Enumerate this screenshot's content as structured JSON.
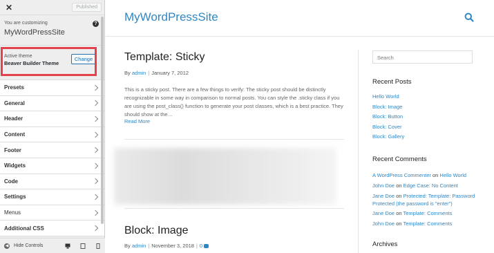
{
  "sidebar": {
    "close_icon": "close-icon",
    "published_label": "Published",
    "customizing_label": "You are customizing",
    "site_name": "MyWordPressSite",
    "help_icon": "?",
    "active_theme_label": "Active theme",
    "theme_name": "Beaver Builder Theme",
    "change_label": "Change",
    "items": [
      {
        "label": "Presets"
      },
      {
        "label": "General"
      },
      {
        "label": "Header"
      },
      {
        "label": "Content"
      },
      {
        "label": "Footer"
      },
      {
        "label": "Widgets"
      },
      {
        "label": "Code"
      },
      {
        "label": "Settings"
      },
      {
        "label": "Menus"
      },
      {
        "label": "Additional CSS"
      }
    ],
    "hide_controls_label": "Hide Controls",
    "highlight_color": "#e5414a"
  },
  "preview": {
    "site_title": "MyWordPressSite",
    "accent_color": "#2e87c7",
    "posts": [
      {
        "title": "Template: Sticky",
        "by": "By",
        "author": "admin",
        "date": "January 7, 2012",
        "excerpt": "This is a sticky post. There are a few things to verify: The sticky post should be distinctly recognizable in some way in comparison to normal posts. You can style the .sticky class if you are using the post_class() function to generate your post classes, which is a best practice. They should show at the…",
        "read_more": "Read More"
      },
      {
        "title": "Block: Image",
        "by": "By",
        "author": "admin",
        "date": "November 3, 2018",
        "comments": "0"
      }
    ],
    "sidebar": {
      "search_placeholder": "Search",
      "recent_posts_title": "Recent Posts",
      "recent_posts": [
        "Hello World",
        "Block: Image",
        "Block: Button",
        "Block: Cover",
        "Block: Gallery"
      ],
      "recent_comments_title": "Recent Comments",
      "recent_comments": [
        {
          "author": "A WordPress Commenter",
          "on": "on",
          "post": "Hello World"
        },
        {
          "author": "John Doe",
          "on": "on",
          "post": "Edge Case: No Content"
        },
        {
          "author": "Jane Doe",
          "on": "on",
          "post": "Protected: Template: Password Protected (the password is \"enter\")"
        },
        {
          "author": "Jane Doe",
          "on": "on",
          "post": "Template: Comments"
        },
        {
          "author": "John Doe",
          "on": "on",
          "post": "Template: Comments"
        }
      ],
      "archives_title": "Archives"
    }
  }
}
